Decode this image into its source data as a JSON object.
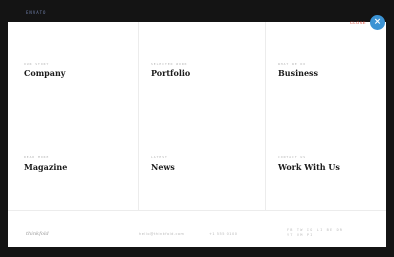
{
  "header": {
    "brand": "ENVATO",
    "close_label": "CLOSE",
    "close_icon": "×"
  },
  "menu": {
    "items": [
      {
        "kicker": "OUR STORY",
        "label": "Company"
      },
      {
        "kicker": "SELECTED WORK",
        "label": "Portfolio"
      },
      {
        "kicker": "WHAT WE DO",
        "label": "Business"
      },
      {
        "kicker": "READ MORE",
        "label": "Magazine"
      },
      {
        "kicker": "LATEST",
        "label": "News"
      },
      {
        "kicker": "CONTACT US",
        "label": "Work With Us"
      }
    ]
  },
  "footer": {
    "logo": "thinkfold",
    "email": "hello@thinkfold.com",
    "phone": "+1 555 0100",
    "social_line1": "FB  TW  IG  LI  BE  DR",
    "social_line2": "YT  VM  PI"
  }
}
